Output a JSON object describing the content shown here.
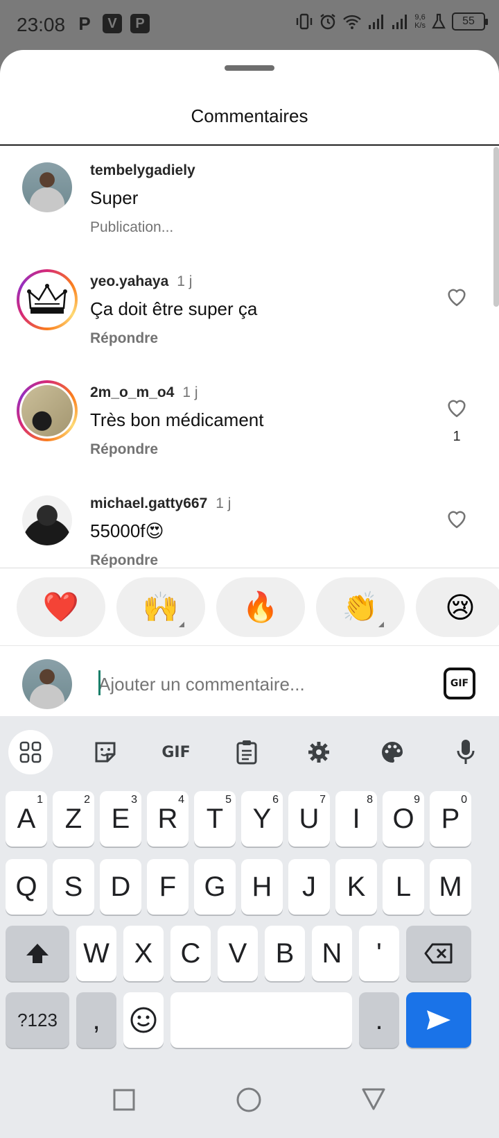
{
  "status": {
    "time": "23:08",
    "apps": [
      "P",
      "V",
      "P"
    ],
    "speed_value": "9,6",
    "speed_unit": "K/s",
    "battery": "55"
  },
  "sheet": {
    "title": "Commentaires"
  },
  "comments": [
    {
      "user": "tembelygadiely",
      "time": "",
      "text": "Super",
      "sub": "Publication...",
      "likes": ""
    },
    {
      "user": "yeo.yahaya",
      "time": "1 j",
      "text": "Ça doit être super ça",
      "sub": "Répondre",
      "likes": ""
    },
    {
      "user": "2m_o_m_o4",
      "time": "1 j",
      "text": "Très bon médicament",
      "sub": "Répondre",
      "likes": "1"
    },
    {
      "user": "michael.gatty667",
      "time": "1 j",
      "text": "55000f😍",
      "sub": "Répondre",
      "likes": ""
    }
  ],
  "reactions": [
    "❤️",
    "🙌",
    "🔥",
    "👏",
    "😢"
  ],
  "input": {
    "placeholder": "Ajouter un commentaire...",
    "gif_label": "GIF"
  },
  "keyboard": {
    "toolbar": {
      "gif_label": "GIF"
    },
    "row1": [
      {
        "key": "A",
        "hint": "1"
      },
      {
        "key": "Z",
        "hint": "2"
      },
      {
        "key": "E",
        "hint": "3"
      },
      {
        "key": "R",
        "hint": "4"
      },
      {
        "key": "T",
        "hint": "5"
      },
      {
        "key": "Y",
        "hint": "6"
      },
      {
        "key": "U",
        "hint": "7"
      },
      {
        "key": "I",
        "hint": "8"
      },
      {
        "key": "O",
        "hint": "9"
      },
      {
        "key": "P",
        "hint": "0"
      }
    ],
    "row2": [
      "Q",
      "S",
      "D",
      "F",
      "G",
      "H",
      "J",
      "K",
      "L",
      "M"
    ],
    "row3": [
      "W",
      "X",
      "C",
      "V",
      "B",
      "N",
      "'"
    ],
    "bottom": {
      "symbols": "?123",
      "comma": ",",
      "period": "."
    }
  }
}
